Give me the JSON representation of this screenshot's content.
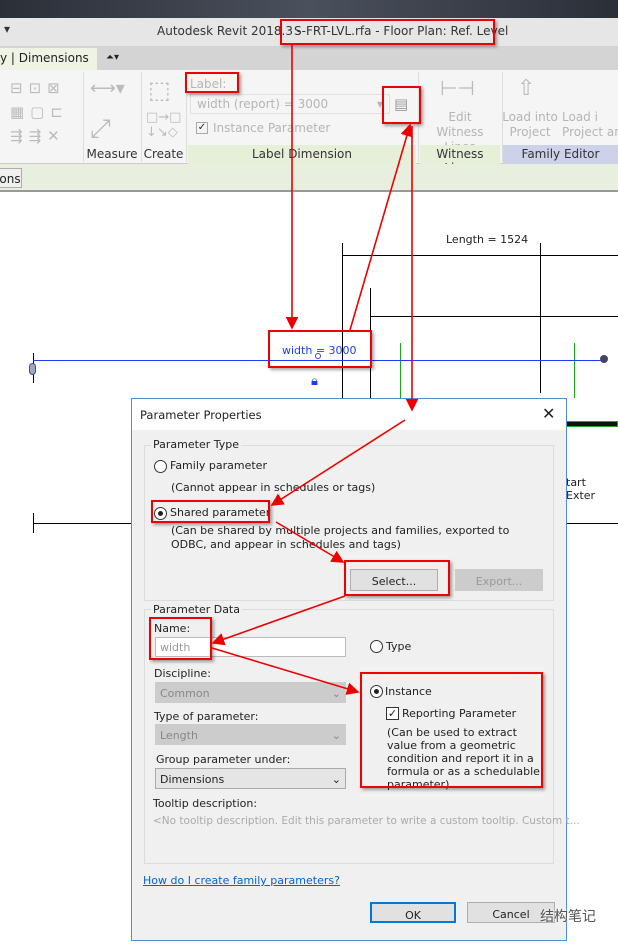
{
  "window": {
    "title_prefix": "Autodesk Revit 2018.3 -",
    "title_file": "S-FRT-LVL.rfa - Floor Plan: Ref. Level"
  },
  "ribbon": {
    "context_tab": "y | Dimensions",
    "panels": {
      "measure": "Measure",
      "create": "Create",
      "label_dimension": "Label Dimension",
      "witness_lines": "Witness Lines",
      "family_editor": "Family Editor"
    },
    "label_caption": "Label:",
    "label_value": "width (report) = 3000",
    "instance_parameter": "Instance Parameter",
    "instance_checked": true,
    "edit_witness_lines": [
      "Edit",
      "Witness Lines"
    ],
    "load_into_project": [
      "Load into",
      "Project"
    ],
    "load_into_project_close": [
      "Load i",
      "Project and"
    ]
  },
  "options_bar": {
    "button": "ons"
  },
  "canvas": {
    "length_label": "Length = 1524",
    "width_label": "width = 3000",
    "start_ext": "tart Exter"
  },
  "dialog": {
    "title": "Parameter Properties",
    "type_group": "Parameter Type",
    "family_param": "Family parameter",
    "family_note": "(Cannot appear in schedules or tags)",
    "shared_param": "Shared parameter",
    "shared_note": "(Can be shared by multiple projects and families, exported to ODBC, and appear in schedules and tags)",
    "selected_type": "shared",
    "select_btn": "Select...",
    "export_btn": "Export...",
    "data_group": "Parameter Data",
    "name_label": "Name:",
    "name_value": "width",
    "type_radio": "Type",
    "instance_radio": "Instance",
    "selected_scope": "instance",
    "reporting": "Reporting Parameter",
    "reporting_checked": true,
    "reporting_note": "(Can be used to extract value from a geometric condition and report it in a formula or as a schedulable parameter)",
    "discipline_label": "Discipline:",
    "discipline_value": "Common",
    "typeof_label": "Type of parameter:",
    "typeof_value": "Length",
    "group_label": "Group parameter under:",
    "group_value": "Dimensions",
    "tooltip_label": "Tooltip description:",
    "tooltip_value": "<No tooltip description. Edit this parameter to write a custom tooltip. Custom t...",
    "help_link": "How do I create family parameters?",
    "ok": "OK",
    "cancel": "Cancel"
  },
  "watermark": "结构笔记",
  "colors": {
    "annotation": "#e00000",
    "dim_line": "#1a3cff",
    "link": "#0066cc",
    "ok_border": "#0078d7"
  }
}
